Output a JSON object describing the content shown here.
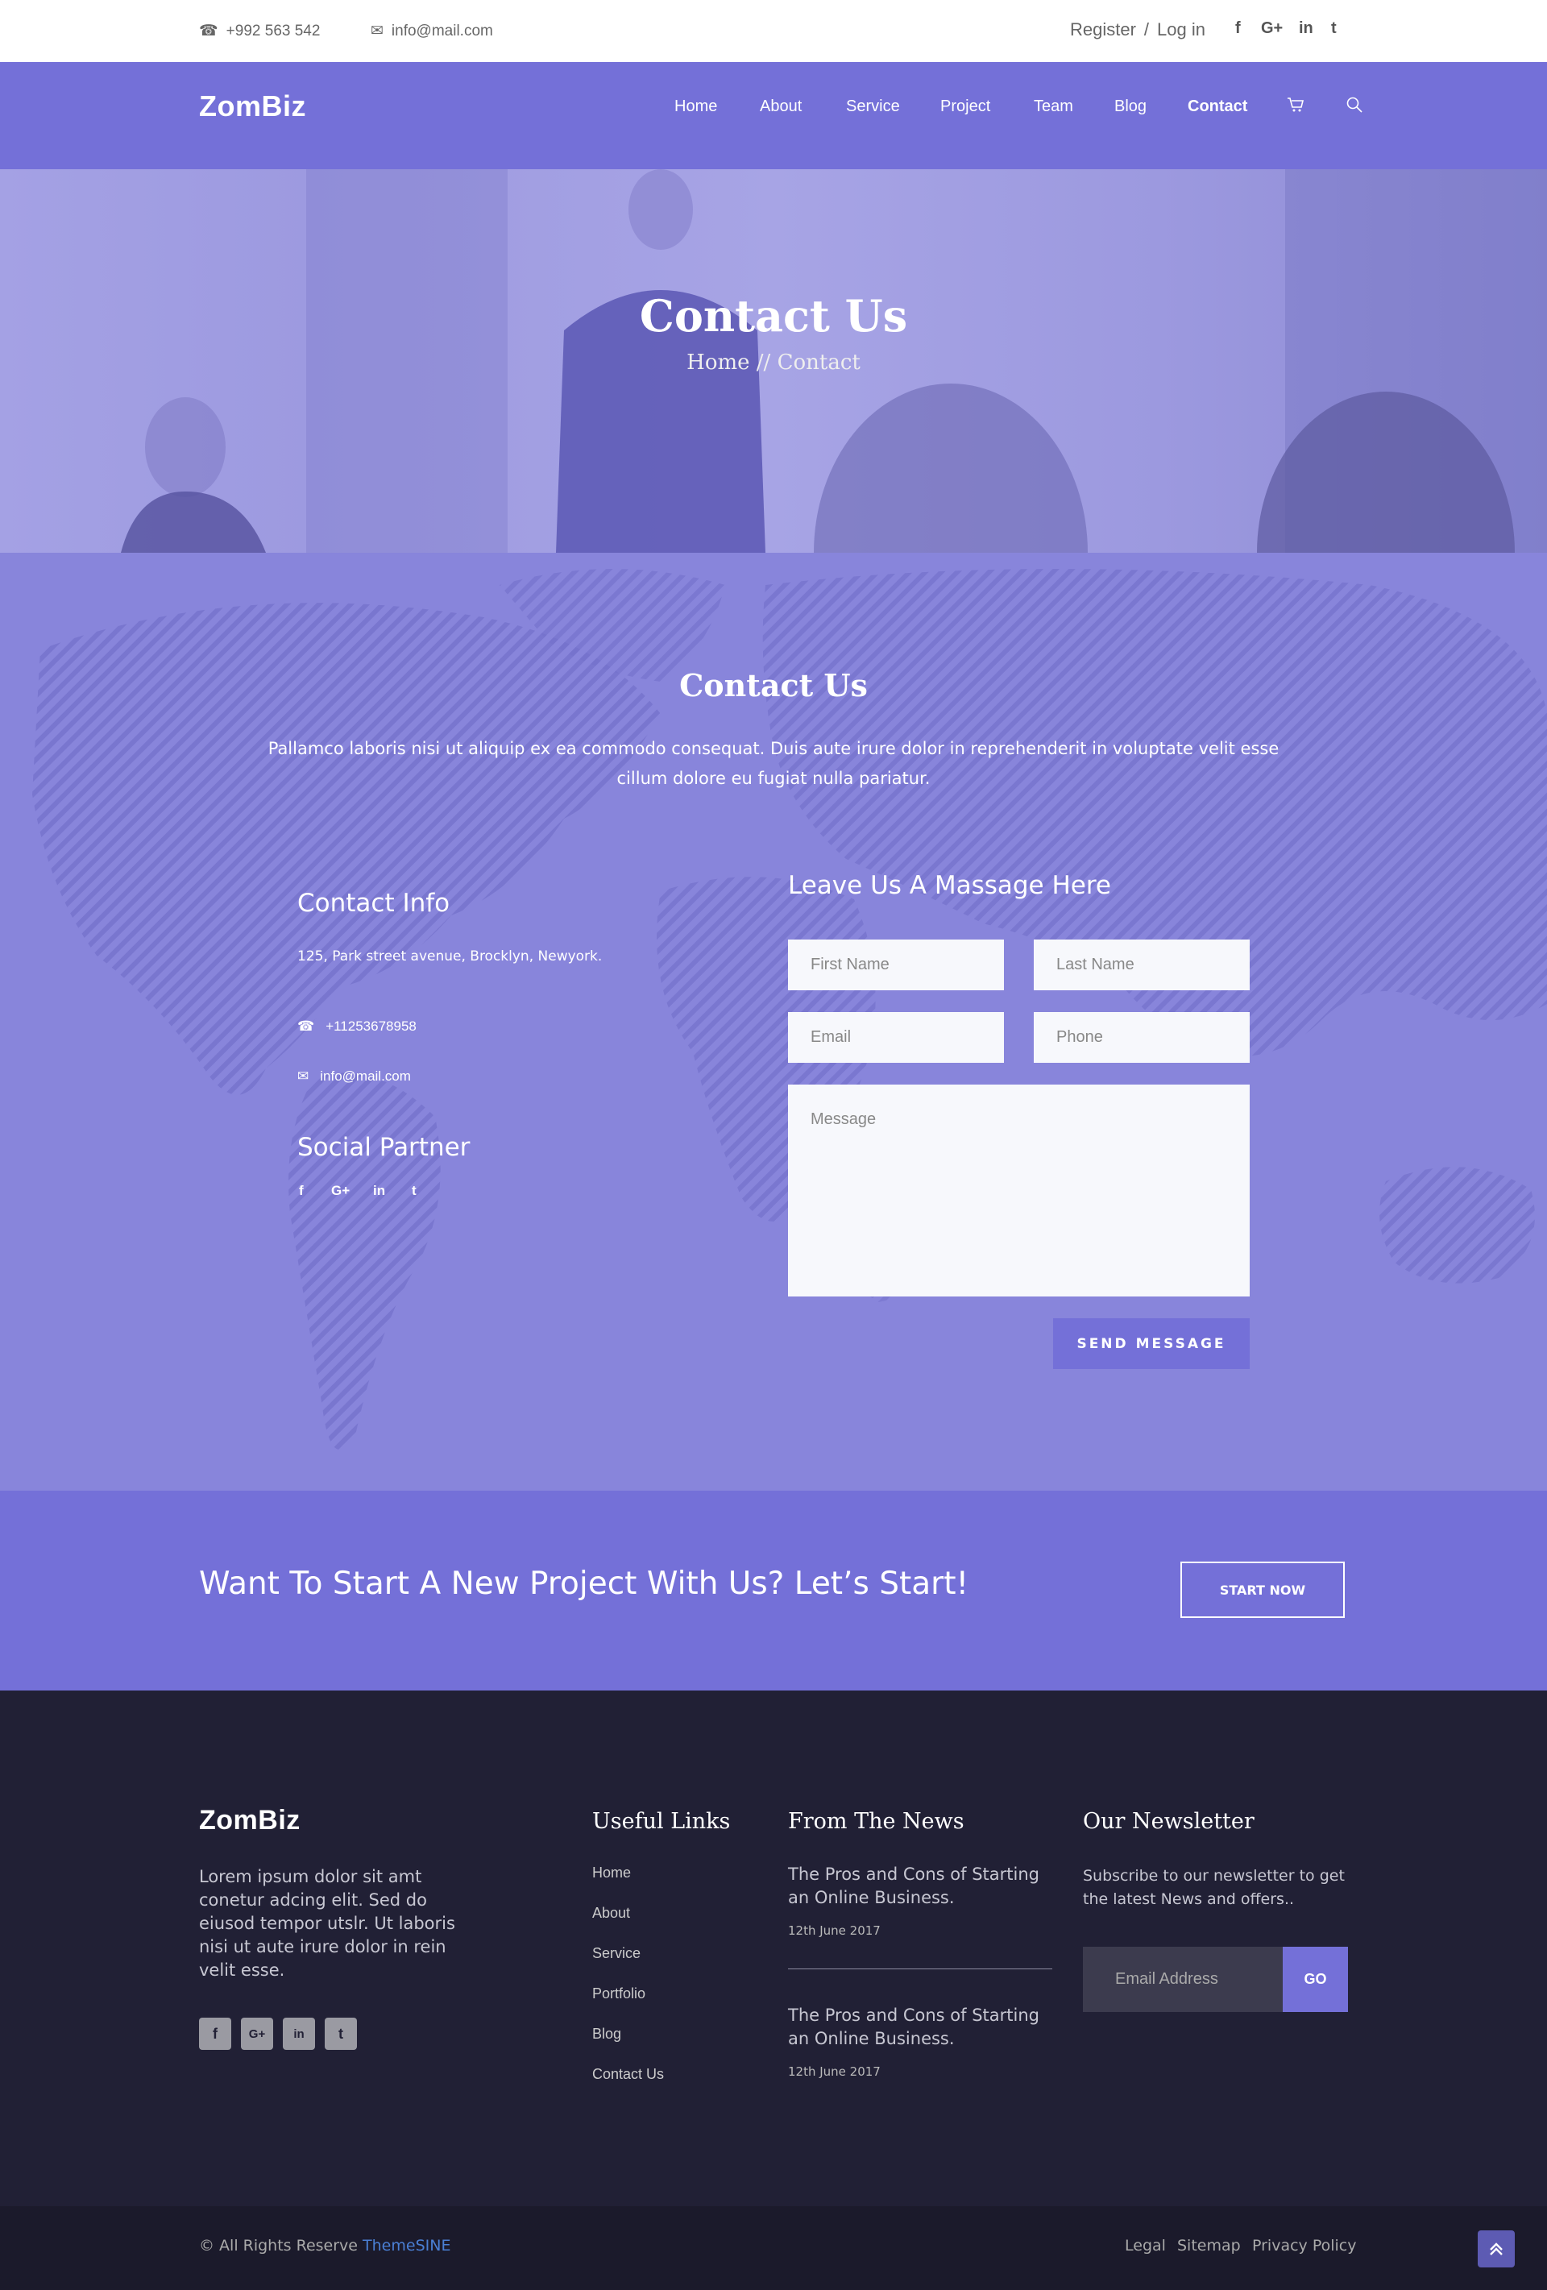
{
  "topbar": {
    "phone": "+992 563 542",
    "email": "info@mail.com",
    "register": "Register",
    "separator": "/",
    "login": "Log in",
    "social": [
      "f",
      "G+",
      "in",
      "t"
    ]
  },
  "nav": {
    "logo": "ZomBiz",
    "items": [
      "Home",
      "About",
      "Service",
      "Project",
      "Team",
      "Blog",
      "Contact"
    ],
    "active": "Contact"
  },
  "hero": {
    "title": "Contact Us",
    "breadcrumb_home": "Home",
    "breadcrumb_sep": "//",
    "breadcrumb_current": "Contact"
  },
  "contact": {
    "title": "Contact Us",
    "intro": "Pallamco laboris nisi ut aliquip ex ea commodo consequat. Duis aute irure dolor in reprehenderit in voluptate velit esse cillum dolore eu fugiat nulla pariatur.",
    "info_title": "Contact Info",
    "address": "125, Park street avenue, Brocklyn, Newyork.",
    "phone": "+11253678958",
    "email": "info@mail.com",
    "social_title": "Social Partner",
    "social": [
      "f",
      "G+",
      "in",
      "t"
    ],
    "form_title": "Leave Us A Massage Here",
    "first_name_ph": "First Name",
    "last_name_ph": "Last Name",
    "email_ph": "Email",
    "phone_ph": "Phone",
    "message_ph": "Message",
    "send_label": "SEND MESSAGE"
  },
  "cta": {
    "text": "Want To Start A New Project With Us? Let’s Start!",
    "button": "START NOW"
  },
  "footer": {
    "logo": "ZomBiz",
    "description": "Lorem ipsum dolor sit amt conetur adcing elit. Sed do eiusod tempor utslr. Ut laboris nisi ut aute irure dolor in rein velit esse.",
    "social": [
      "f",
      "G+",
      "in",
      "t"
    ],
    "links_title": "Useful Links",
    "links": [
      "Home",
      "About",
      "Service",
      "Portfolio",
      "Blog",
      "Contact Us"
    ],
    "news_title": "From The News",
    "news": [
      {
        "title": "The Pros and Cons of Starting an Online Business.",
        "date": "12th June 2017"
      },
      {
        "title": "The Pros and Cons of Starting an Online Business.",
        "date": "12th June 2017"
      }
    ],
    "newsletter_title": "Our Newsletter",
    "newsletter_text": "Subscribe to our newsletter to get the latest News and offers..",
    "newsletter_placeholder": "Email Address",
    "newsletter_button": "GO"
  },
  "bottom": {
    "copyright": "© All Rights Reserve",
    "brand": "ThemeSINE",
    "links": [
      "Legal",
      "Sitemap",
      "Privacy Policy"
    ]
  },
  "colors": {
    "accent": "#7470d8",
    "footer_bg": "#212035",
    "bottom_bg": "#1b1a2b",
    "brand_link": "#4a7fd4"
  },
  "icons": [
    "phone-icon",
    "envelope-icon",
    "cart-icon",
    "search-icon",
    "chevron-up-icon"
  ]
}
